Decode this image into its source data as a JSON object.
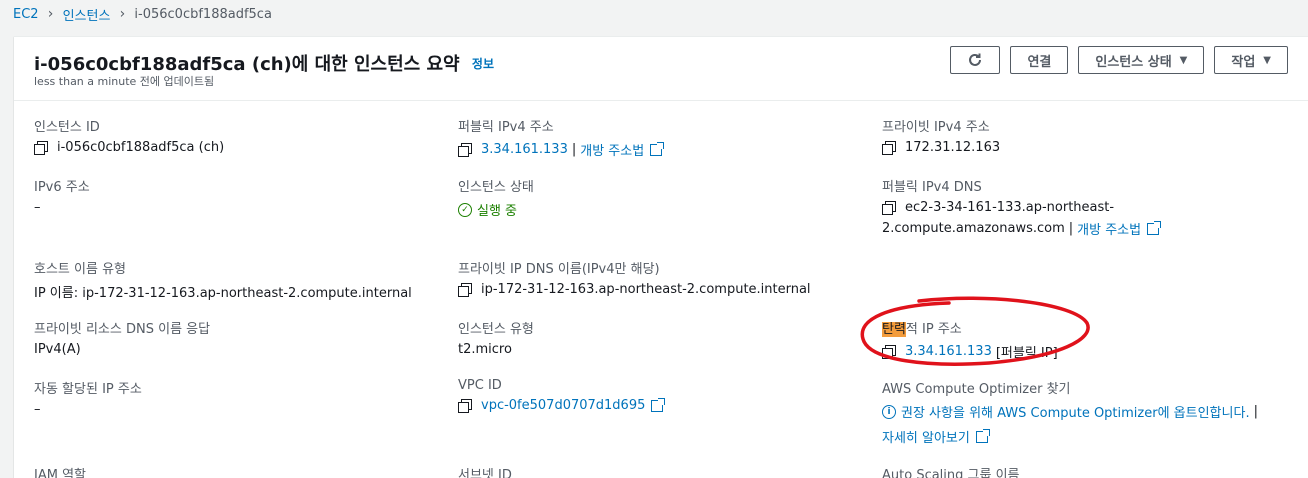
{
  "breadcrumb": {
    "items": [
      "EC2",
      "인스턴스"
    ],
    "current": "i-056c0cbf188adf5ca"
  },
  "header": {
    "title": "i-056c0cbf188adf5ca (ch)에 대한 인스턴스 요약",
    "info_link": "정보",
    "subtitle": "less than a minute 전에 업데이트됨",
    "buttons": {
      "refresh_icon": "refresh-icon",
      "connect": "연결",
      "instance_state": "인스턴스 상태",
      "actions": "작업"
    }
  },
  "fields": {
    "instance_id": {
      "label": "인스턴스 ID",
      "value": "i-056c0cbf188adf5ca (ch)"
    },
    "public_ipv4": {
      "label": "퍼블릭 IPv4 주소",
      "value": "3.34.161.133",
      "link": "개방 주소법"
    },
    "private_ipv4": {
      "label": "프라이빗 IPv4 주소",
      "value": "172.31.12.163"
    },
    "ipv6": {
      "label": "IPv6 주소",
      "value": "–"
    },
    "instance_state": {
      "label": "인스턴스 상태",
      "value": "실행 중"
    },
    "public_dns": {
      "label": "퍼블릭 IPv4 DNS",
      "value_line1": "ec2-3-34-161-133.ap-northeast-",
      "value_line2": "2.compute.amazonaws.com",
      "link": "개방 주소법"
    },
    "hostname_type": {
      "label": "호스트 이름 유형",
      "value": "IP 이름: ip-172-31-12-163.ap-northeast-2.compute.internal"
    },
    "private_dns": {
      "label": "프라이빗 IP DNS 이름(IPv4만 해당)",
      "value": "ip-172-31-12-163.ap-northeast-2.compute.internal"
    },
    "resource_dns": {
      "label": "프라이빗 리소스 DNS 이름 응답",
      "value": "IPv4(A)"
    },
    "instance_type": {
      "label": "인스턴스 유형",
      "value": "t2.micro"
    },
    "elastic_ip": {
      "label_highlight": "탄력",
      "label_rest": "적 IP 주소",
      "value": "3.34.161.133",
      "suffix": "[퍼블릭 IP]"
    },
    "auto_ip": {
      "label": "자동 할당된 IP 주소",
      "value": "–"
    },
    "vpc_id": {
      "label": "VPC ID",
      "value": "vpc-0fe507d0707d1d695"
    },
    "optimizer": {
      "label": "AWS Compute Optimizer 찾기",
      "value": "권장 사항을 위해 AWS Compute Optimizer에 옵트인합니다.",
      "pipe": "|",
      "link": "자세히 알아보기"
    },
    "iam_role": {
      "label": "IAM 역할"
    },
    "subnet_id": {
      "label": "서브넷 ID"
    },
    "asg_name": {
      "label": "Auto Scaling 그룹 이름"
    }
  },
  "colors": {
    "link": "#0073bb",
    "success": "#1d8102",
    "highlight": "#f39c3c",
    "annotation": "#e0121b"
  }
}
